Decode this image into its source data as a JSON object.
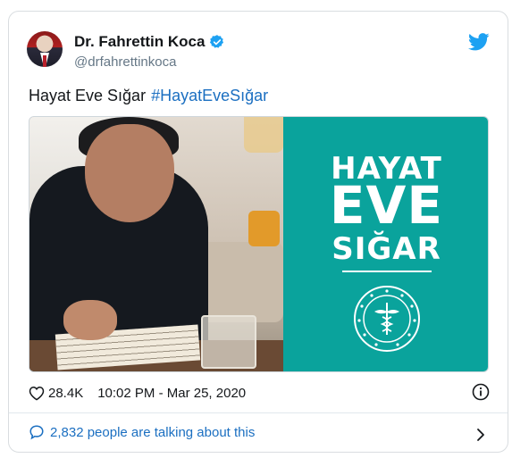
{
  "author": {
    "name": "Dr. Fahrettin Koca",
    "handle": "@drfahrettinkoca"
  },
  "tweet": {
    "text": "Hayat Eve Sığar",
    "hashtag": "#HayatEveSığar"
  },
  "media": {
    "slogan_line1": "HAYAT",
    "slogan_line2": "EVE",
    "slogan_line3": "SIĞAR"
  },
  "meta": {
    "likes": "28.4K",
    "timestamp": "10:02 PM - Mar 25, 2020"
  },
  "footer": {
    "talking": "2,832 people are talking about this"
  },
  "colors": {
    "link": "#1b6fc1",
    "panel": "#0aa39c",
    "twitter_blue": "#1da1f2"
  },
  "icons": [
    "verified-badge-icon",
    "twitter-bird-icon",
    "heart-icon",
    "info-icon",
    "speech-bubble-icon",
    "chevron-right-icon"
  ]
}
